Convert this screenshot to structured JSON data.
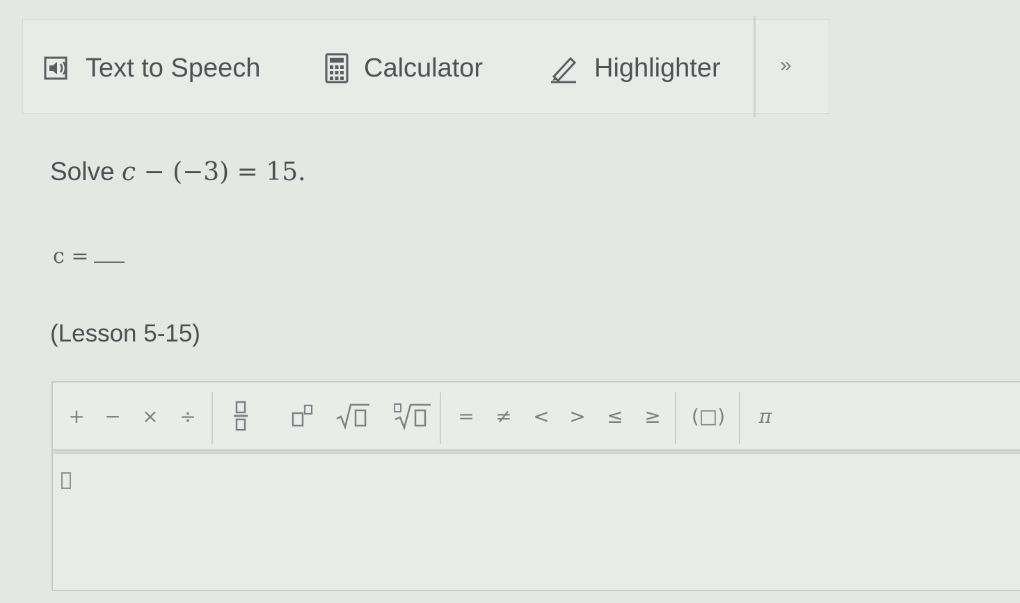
{
  "toolbar": {
    "text_to_speech_label": "Text to Speech",
    "calculator_label": "Calculator",
    "highlighter_label": "Highlighter",
    "more_label": "»"
  },
  "question": {
    "prefix": "Solve",
    "variable": "c",
    "equation_rest": " − (−3) = 15.",
    "answer_prefix": "c ="
  },
  "lesson_label": "(Lesson 5-15)",
  "palette": {
    "ops": [
      "+",
      "−",
      "×",
      "÷"
    ],
    "relations": [
      "=",
      "≠",
      "<",
      ">",
      "≤",
      "≥"
    ],
    "paren_label": "(□)",
    "pi_label": "π"
  },
  "colors": {
    "background": "#e4e7e2",
    "text": "#4b4f52",
    "icon": "#7d8185"
  }
}
